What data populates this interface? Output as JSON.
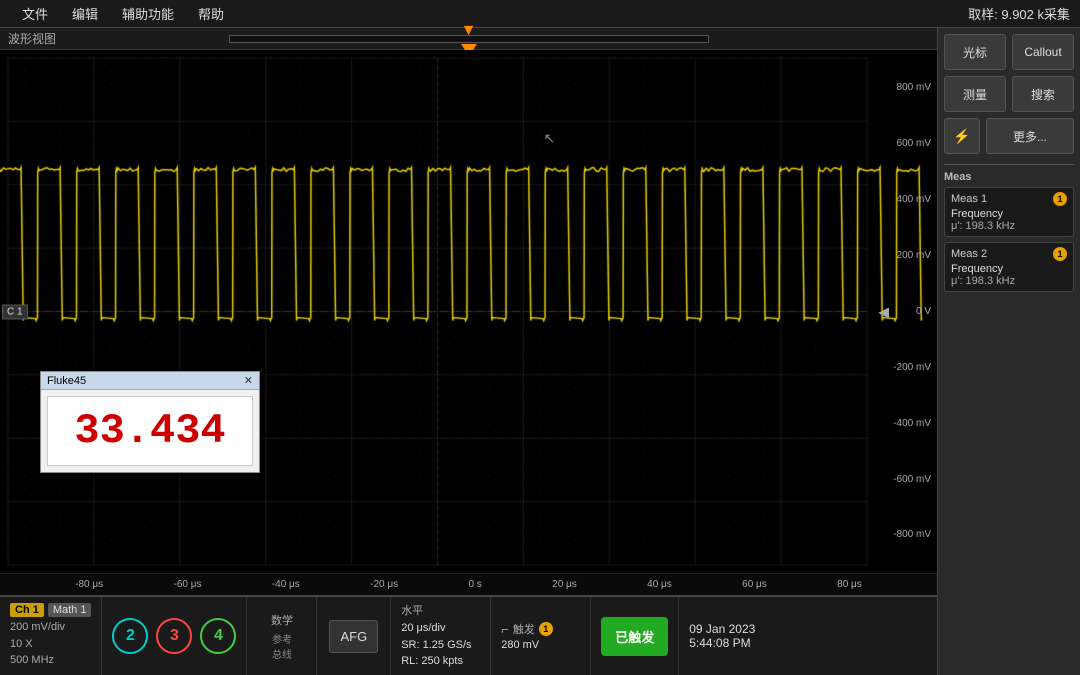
{
  "menu": {
    "items": [
      "文件",
      "编辑",
      "辅助功能",
      "帮助"
    ],
    "sample_info": "取样: 9.902 k采集"
  },
  "waveform": {
    "title": "波形视图",
    "voltage_labels": [
      "800 mV",
      "600 mV",
      "400 mV",
      "200 mV",
      "0 V",
      "-200 mV",
      "-400 mV",
      "-600 mV",
      "-800 mV"
    ],
    "time_labels": [
      "-80 μs",
      "-60 μs",
      "-40 μs",
      "-20 μs",
      "0 s",
      "20 μs",
      "40 μs",
      "60 μs",
      "80 μs"
    ],
    "c1_label": "C 1"
  },
  "fluke": {
    "title": "Fluke45",
    "value": "33.434",
    "close": "✕"
  },
  "right_panel": {
    "btn_cursor": "光标",
    "btn_callout": "Callout",
    "btn_measure": "测量",
    "btn_search": "搜索",
    "btn_more": "更多...",
    "meas_label": "Meas",
    "meas1": {
      "title": "Meas 1",
      "badge": "1",
      "param": "Frequency",
      "value": "μ': 198.3 kHz"
    },
    "meas2": {
      "title": "Meas 2",
      "badge": "1",
      "param": "Frequency",
      "value": "μ': 198.3 kHz"
    }
  },
  "bottom_bar": {
    "ch1_label": "Ch 1",
    "ch1_detail_line1": "200 mV/div",
    "ch1_detail_line2": "10 X",
    "ch1_detail_line3": "500 MHz",
    "math1_label": "Math 1",
    "math1_value": "1",
    "ch2_label": "2",
    "ch3_label": "3",
    "ch4_label": "4",
    "math_title": "数学",
    "math_sub1": "参考",
    "math_sub2": "总线",
    "afg_label": "AFG",
    "horiz_title": "水平",
    "horiz_detail1": "20 μs/div",
    "horiz_detail2": "SR: 1.25 GS/s",
    "horiz_detail3": "RL: 250 kpts",
    "trigger_title": "触发",
    "trigger_badge": "1",
    "trigger_val": "280 mV",
    "triggered_label": "已触发",
    "date": "09 Jan 2023",
    "time": "5:44:08 PM"
  }
}
